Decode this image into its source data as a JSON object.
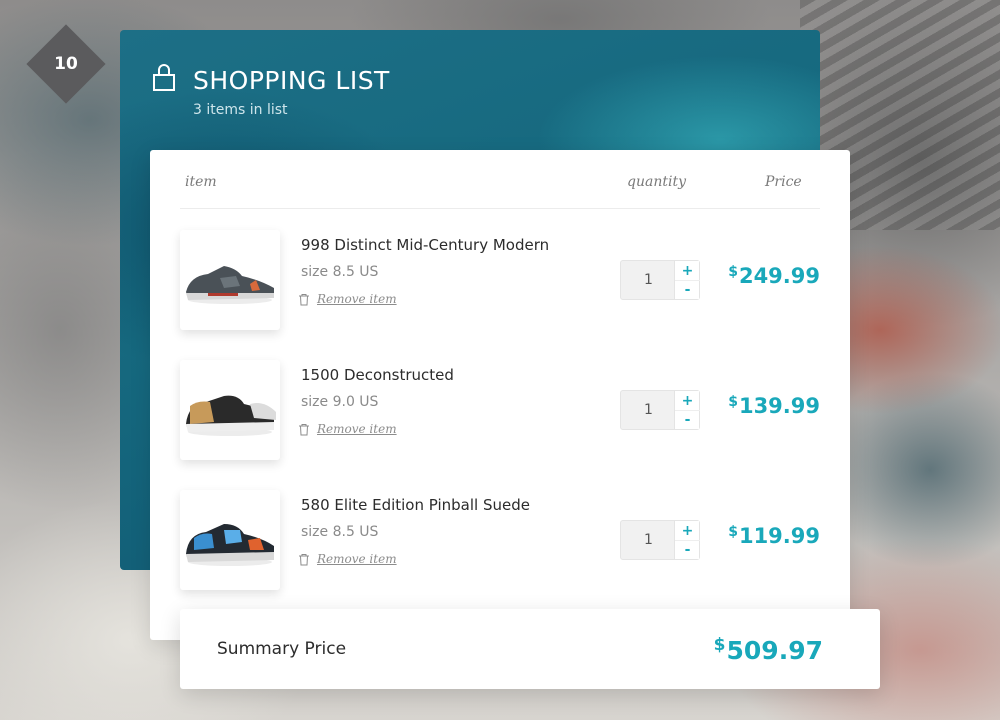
{
  "badge": {
    "number": "10"
  },
  "header": {
    "title": "SHOPPING LIST",
    "subtitle": "3 items in list",
    "icon": "shopping-bag-icon"
  },
  "table": {
    "columns": {
      "item": "item",
      "quantity": "quantity",
      "price": "Price"
    },
    "rows": [
      {
        "name": "998 Distinct Mid-Century Modern",
        "size": "size 8.5 US",
        "remove_label": "Remove item",
        "quantity": "1",
        "currency": "$",
        "price": "249.99"
      },
      {
        "name": "1500 Deconstructed",
        "size": "size 9.0 US",
        "remove_label": "Remove item",
        "quantity": "1",
        "currency": "$",
        "price": "139.99"
      },
      {
        "name": "580 Elite Edition Pinball Suede",
        "size": "size 8.5 US",
        "remove_label": "Remove item",
        "quantity": "1",
        "currency": "$",
        "price": "119.99"
      }
    ],
    "stepper": {
      "plus": "+",
      "minus": "-"
    }
  },
  "summary": {
    "label": "Summary Price",
    "currency": "$",
    "total": "509.97"
  },
  "colors": {
    "accent": "#19a8ba",
    "header": "#16697f",
    "badge": "#5b5b5d"
  }
}
